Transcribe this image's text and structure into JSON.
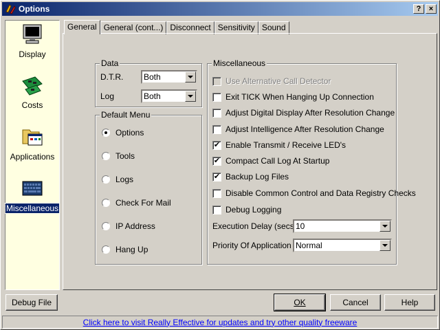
{
  "window": {
    "title": "Options",
    "help_button": "?",
    "close_button": "×"
  },
  "sidebar": {
    "items": [
      {
        "label": "Display",
        "icon": "monitor-icon"
      },
      {
        "label": "Costs",
        "icon": "circuit-board-icon"
      },
      {
        "label": "Applications",
        "icon": "folder-icon"
      },
      {
        "label": "Miscellaneous",
        "icon": "keyboard-icon",
        "selected": true
      }
    ]
  },
  "tabs": [
    {
      "label": "General",
      "active": true
    },
    {
      "label": "General (cont...)"
    },
    {
      "label": "Disconnect"
    },
    {
      "label": "Sensitivity"
    },
    {
      "label": "Sound"
    }
  ],
  "data_group": {
    "title": "Data",
    "dtr_label": "D.T.R.",
    "dtr_value": "Both",
    "log_label": "Log",
    "log_value": "Both"
  },
  "default_menu": {
    "title": "Default Menu",
    "options": [
      {
        "label": "Options",
        "selected": true
      },
      {
        "label": "Tools"
      },
      {
        "label": "Logs"
      },
      {
        "label": "Check For Mail"
      },
      {
        "label": "IP Address"
      },
      {
        "label": "Hang Up"
      }
    ]
  },
  "misc": {
    "title": "Miscellaneous",
    "checks": [
      {
        "label": "Use Alternative Call Detector",
        "checked": false,
        "disabled": true
      },
      {
        "label": "Exit TICK When Hanging Up Connection",
        "checked": false
      },
      {
        "label": "Adjust Digital Display After Resolution Change",
        "checked": false
      },
      {
        "label": "Adjust Intelligence After Resolution Change",
        "checked": false
      },
      {
        "label": "Enable Transmit / Receive LED's",
        "checked": true
      },
      {
        "label": "Compact Call Log At Startup",
        "checked": true
      },
      {
        "label": "Backup Log Files",
        "checked": true
      },
      {
        "label": "Disable Common Control and Data Registry Checks",
        "checked": false
      },
      {
        "label": "Debug Logging",
        "checked": false
      }
    ],
    "exec_delay_label": "Execution Delay (secs)",
    "exec_delay_value": "10",
    "priority_label": "Priority Of Application",
    "priority_value": "Normal"
  },
  "buttons": {
    "debug_file": "Debug File",
    "ok": "OK",
    "cancel": "Cancel",
    "help": "Help"
  },
  "status_link": "Click here to visit Really Effective for updates and try other quality freeware",
  "colors": {
    "title_start": "#0a246a",
    "title_end": "#a6caf0",
    "sidebar_bg": "#ffffe1",
    "face": "#d4d0c8",
    "link": "#0000ff"
  }
}
